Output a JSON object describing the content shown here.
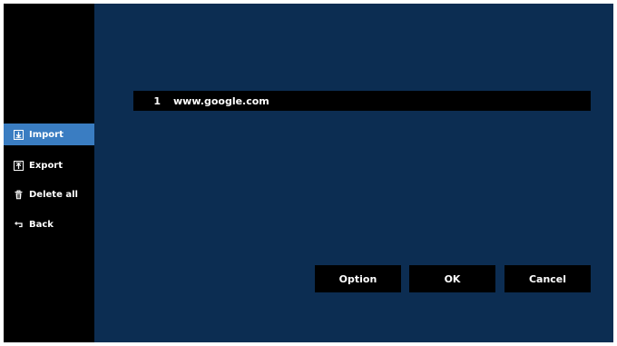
{
  "sidebar": {
    "items": [
      {
        "label": "Import",
        "icon": "import-icon",
        "selected": true
      },
      {
        "label": "Export",
        "icon": "export-icon",
        "selected": false
      },
      {
        "label": "Delete all",
        "icon": "trash-icon",
        "selected": false
      },
      {
        "label": "Back",
        "icon": "back-arrow-icon",
        "selected": false
      }
    ]
  },
  "url_list": {
    "rows": [
      {
        "index": "1",
        "url": "www.google.com"
      }
    ]
  },
  "actions": {
    "option_label": "Option",
    "ok_label": "OK",
    "cancel_label": "Cancel"
  },
  "colors": {
    "background": "#0c2d52",
    "sidebar": "#000000",
    "selected": "#3a7dc2",
    "text": "#ffffff"
  }
}
